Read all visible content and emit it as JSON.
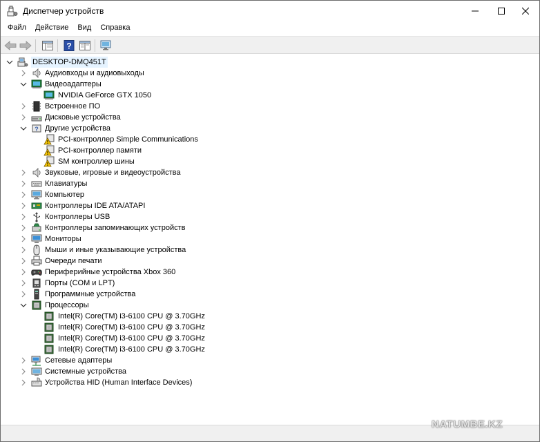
{
  "window": {
    "title": "Диспетчер устройств"
  },
  "menu": [
    "Файл",
    "Действие",
    "Вид",
    "Справка"
  ],
  "tree": {
    "root": "DESKTOP-DMQ451T",
    "categories": [
      {
        "label": "Аудиовходы и аудиовыходы",
        "icon": "speaker-icon",
        "expanded": false,
        "children": []
      },
      {
        "label": "Видеоадаптеры",
        "icon": "display-adapter-icon",
        "expanded": true,
        "children": [
          {
            "label": "NVIDIA GeForce GTX 1050",
            "icon": "display-adapter-icon"
          }
        ]
      },
      {
        "label": "Встроенное ПО",
        "icon": "firmware-icon",
        "expanded": false,
        "children": []
      },
      {
        "label": "Дисковые устройства",
        "icon": "disk-drive-icon",
        "expanded": false,
        "children": []
      },
      {
        "label": "Другие устройства",
        "icon": "unknown-device-icon",
        "expanded": true,
        "children": [
          {
            "label": "PCI-контроллер Simple Communications",
            "icon": "warning-device-icon"
          },
          {
            "label": "PCI-контроллер памяти",
            "icon": "warning-device-icon"
          },
          {
            "label": "SM контроллер шины",
            "icon": "warning-device-icon"
          }
        ]
      },
      {
        "label": "Звуковые, игровые и видеоустройства",
        "icon": "speaker-icon",
        "expanded": false,
        "children": []
      },
      {
        "label": "Клавиатуры",
        "icon": "keyboard-icon",
        "expanded": false,
        "children": []
      },
      {
        "label": "Компьютер",
        "icon": "computer-icon",
        "expanded": false,
        "children": []
      },
      {
        "label": "Контроллеры IDE ATA/ATAPI",
        "icon": "ide-controller-icon",
        "expanded": false,
        "children": []
      },
      {
        "label": "Контроллеры USB",
        "icon": "usb-icon",
        "expanded": false,
        "children": []
      },
      {
        "label": "Контроллеры запоминающих устройств",
        "icon": "storage-controller-icon",
        "expanded": false,
        "children": []
      },
      {
        "label": "Мониторы",
        "icon": "monitor-icon",
        "expanded": false,
        "children": []
      },
      {
        "label": "Мыши и иные указывающие устройства",
        "icon": "mouse-icon",
        "expanded": false,
        "children": []
      },
      {
        "label": "Очереди печати",
        "icon": "printer-icon",
        "expanded": false,
        "children": []
      },
      {
        "label": "Периферийные устройства Xbox 360",
        "icon": "gamepad-icon",
        "expanded": false,
        "children": []
      },
      {
        "label": "Порты (COM и LPT)",
        "icon": "port-icon",
        "expanded": false,
        "children": []
      },
      {
        "label": "Программные устройства",
        "icon": "software-device-icon",
        "expanded": false,
        "children": []
      },
      {
        "label": "Процессоры",
        "icon": "processor-icon",
        "expanded": true,
        "children": [
          {
            "label": "Intel(R) Core(TM) i3-6100 CPU @ 3.70GHz",
            "icon": "processor-icon"
          },
          {
            "label": "Intel(R) Core(TM) i3-6100 CPU @ 3.70GHz",
            "icon": "processor-icon"
          },
          {
            "label": "Intel(R) Core(TM) i3-6100 CPU @ 3.70GHz",
            "icon": "processor-icon"
          },
          {
            "label": "Intel(R) Core(TM) i3-6100 CPU @ 3.70GHz",
            "icon": "processor-icon"
          }
        ]
      },
      {
        "label": "Сетевые адаптеры",
        "icon": "network-adapter-icon",
        "expanded": false,
        "children": []
      },
      {
        "label": "Системные устройства",
        "icon": "system-device-icon",
        "expanded": false,
        "children": []
      },
      {
        "label": "Устройства HID (Human Interface Devices)",
        "icon": "hid-icon",
        "expanded": false,
        "children": []
      }
    ]
  },
  "watermark": "NATUMBE.KZ"
}
